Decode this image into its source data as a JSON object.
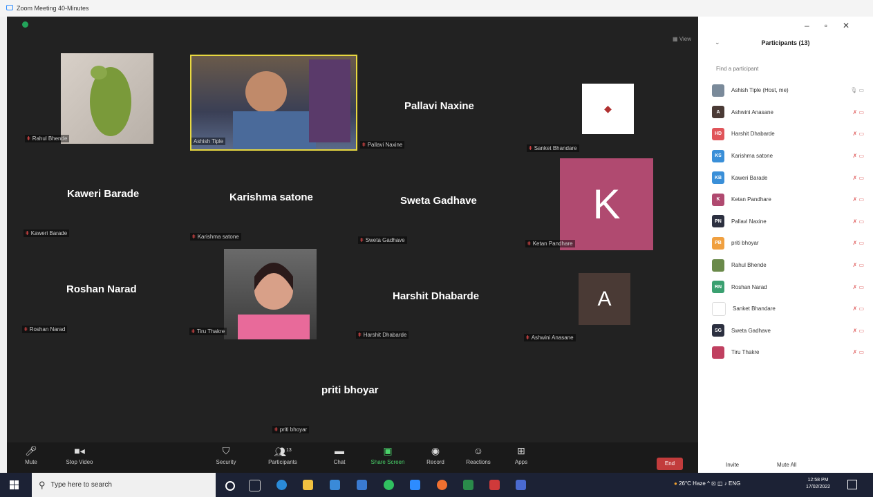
{
  "window": {
    "title": "Zoom Meeting 40-Minutes"
  },
  "meeting": {
    "view_label": "View",
    "tiles": [
      {
        "id": "rahul",
        "label": "Rahul Bhende"
      },
      {
        "id": "ashish",
        "label": "Ashish Tiple"
      },
      {
        "id": "pallavi",
        "display": "Pallavi Naxine",
        "label": "Pallavi Naxine"
      },
      {
        "id": "sanket",
        "label": "Sanket Bhandare"
      },
      {
        "id": "kaweri",
        "display": "Kaweri Barade",
        "label": "Kaweri Barade"
      },
      {
        "id": "karishma",
        "display": "Karishma satone",
        "label": "Karishma satone"
      },
      {
        "id": "sweta",
        "display": "Sweta Gadhave",
        "label": "Sweta Gadhave"
      },
      {
        "id": "ketan",
        "avatar": "K",
        "label": "Ketan Pandhare"
      },
      {
        "id": "roshan",
        "display": "Roshan Narad",
        "label": "Roshan Narad"
      },
      {
        "id": "tiru",
        "label": "Tiru Thakre"
      },
      {
        "id": "harshit",
        "display": "Harshit Dhabarde",
        "label": "Harshit Dhabarde"
      },
      {
        "id": "ashwini",
        "avatar": "A",
        "label": "Ashwini Anasane"
      },
      {
        "id": "priti",
        "display": "priti bhoyar",
        "label": "priti bhoyar"
      }
    ]
  },
  "toolbar": {
    "mute": "Mute",
    "stop_video": "Stop Video",
    "security": "Security",
    "participants": "Participants",
    "participants_count": "13",
    "chat": "Chat",
    "share_screen": "Share Screen",
    "record": "Record",
    "reactions": "Reactions",
    "apps": "Apps",
    "end": "End"
  },
  "panel": {
    "title": "Participants (13)",
    "search_placeholder": "Find a participant",
    "participants": [
      {
        "name": "Ashish Tiple (Host, me)",
        "initials": "",
        "color": "#7a8a9a"
      },
      {
        "name": "Ashwini Anasane",
        "initials": "A",
        "color": "#4a3a35"
      },
      {
        "name": "Harshit Dhabarde",
        "initials": "HD",
        "color": "#e0555a"
      },
      {
        "name": "Karishma satone",
        "initials": "KS",
        "color": "#3a8fd8"
      },
      {
        "name": "Kaweri Barade",
        "initials": "KB",
        "color": "#3a8fd8"
      },
      {
        "name": "Ketan Pandhare",
        "initials": "K",
        "color": "#b04a70"
      },
      {
        "name": "Pallavi Naxine",
        "initials": "PN",
        "color": "#2c3040"
      },
      {
        "name": "priti bhoyar",
        "initials": "PB",
        "color": "#f0a040"
      },
      {
        "name": "Rahul Bhende",
        "initials": "",
        "color": "#6a8a4a"
      },
      {
        "name": "Roshan Narad",
        "initials": "RN",
        "color": "#3aa070"
      },
      {
        "name": "Sanket Bhandare",
        "initials": "",
        "color": "#ffffff"
      },
      {
        "name": "Sweta Gadhave",
        "initials": "SG",
        "color": "#2c3040"
      },
      {
        "name": "Tiru Thakre",
        "initials": "",
        "color": "#c04060"
      }
    ],
    "invite": "Invite",
    "mute_all": "Mute All"
  },
  "taskbar": {
    "search_placeholder": "Type here to search",
    "weather": "26°C Haze",
    "lang": "ENG",
    "time": "12:58 PM",
    "date": "17/02/2022"
  }
}
